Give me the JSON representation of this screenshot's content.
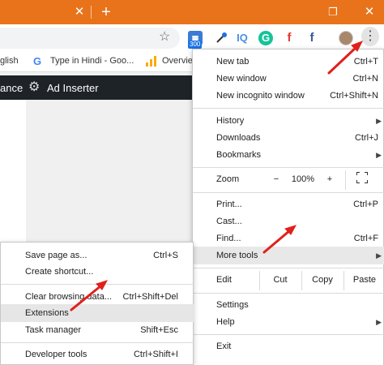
{
  "titlebar": {
    "color": "#e8731a",
    "close_glyph": "✕",
    "new_tab_glyph": "+",
    "restore_glyph": "❐",
    "window_close_glyph": "✕"
  },
  "toolbar": {
    "extensions": [
      {
        "name": "extension-badge-300",
        "text": "",
        "color": "#3a7bd5"
      },
      {
        "name": "eyedropper",
        "text": "",
        "color": "#333333"
      },
      {
        "name": "iq",
        "text": "IQ",
        "color": "#4a90e2"
      },
      {
        "name": "grammarly",
        "text": "G",
        "color": "#15c39a"
      },
      {
        "name": "f-red",
        "text": "f",
        "color": "#e53935"
      },
      {
        "name": "f-blue",
        "text": "f",
        "color": "#3b5998"
      }
    ],
    "badge_text": "300"
  },
  "bookmarks": {
    "item1": "glish",
    "item2": "Type in Hindi - Goo...",
    "item3": "Overvie"
  },
  "wpbar": {
    "left_text": "ance",
    "plugin_label": "Ad Inserter"
  },
  "menu": {
    "items": [
      {
        "label": "New tab",
        "shortcut": "Ctrl+T"
      },
      {
        "label": "New window",
        "shortcut": "Ctrl+N"
      },
      {
        "label": "New incognito window",
        "shortcut": "Ctrl+Shift+N"
      },
      {
        "label": "History",
        "shortcut": ""
      },
      {
        "label": "Downloads",
        "shortcut": "Ctrl+J"
      },
      {
        "label": "Bookmarks",
        "shortcut": ""
      },
      {
        "label": "Print...",
        "shortcut": "Ctrl+P"
      },
      {
        "label": "Cast...",
        "shortcut": ""
      },
      {
        "label": "Find...",
        "shortcut": "Ctrl+F"
      },
      {
        "label": "More tools",
        "shortcut": ""
      },
      {
        "label": "Settings",
        "shortcut": ""
      },
      {
        "label": "Help",
        "shortcut": ""
      },
      {
        "label": "Exit",
        "shortcut": ""
      }
    ],
    "zoom": {
      "label": "Zoom",
      "minus": "−",
      "value": "100%",
      "plus": "+"
    },
    "edit": {
      "label": "Edit",
      "cut": "Cut",
      "copy": "Copy",
      "paste": "Paste"
    }
  },
  "submenu": {
    "items": [
      {
        "label": "Save page as...",
        "shortcut": "Ctrl+S"
      },
      {
        "label": "Create shortcut...",
        "shortcut": ""
      },
      {
        "label": "Clear browsing data...",
        "shortcut": "Ctrl+Shift+Del"
      },
      {
        "label": "Extensions",
        "shortcut": ""
      },
      {
        "label": "Task manager",
        "shortcut": "Shift+Esc"
      },
      {
        "label": "Developer tools",
        "shortcut": "Ctrl+Shift+I"
      }
    ]
  },
  "annotation_color": "#e0201b"
}
